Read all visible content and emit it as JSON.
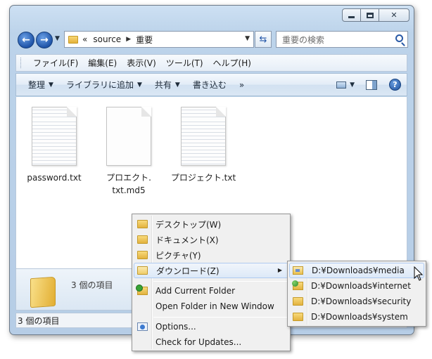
{
  "window": {
    "caption_buttons": {
      "minimize": "minimize",
      "maximize": "maximize",
      "close": "✕"
    }
  },
  "address": {
    "overflow": "«",
    "crumbs": [
      "source",
      "重要"
    ],
    "search_placeholder": "重要の検索"
  },
  "menubar": {
    "items": [
      "ファイル(F)",
      "編集(E)",
      "表示(V)",
      "ツール(T)",
      "ヘルプ(H)"
    ]
  },
  "commandbar": {
    "organize": "整理",
    "add_to_library": "ライブラリに追加",
    "share": "共有",
    "burn": "書き込む",
    "more": "»",
    "help": "?"
  },
  "files": [
    {
      "name": "password.txt",
      "icon": "text-file-icon"
    },
    {
      "name": "プロエクト.\ntxt.md5",
      "icon": "blank-file-icon"
    },
    {
      "name": "プロジェクト.txt",
      "icon": "text-file-icon"
    }
  ],
  "details": {
    "count": "3 個の項目"
  },
  "status": {
    "text": "3 個の項目"
  },
  "context_menu": {
    "items": [
      {
        "label": "デスクトップ(W)",
        "icon": "folder-icon"
      },
      {
        "label": "ドキュメント(X)",
        "icon": "folder-icon"
      },
      {
        "label": "ピクチャ(Y)",
        "icon": "folder-icon"
      },
      {
        "label": "ダウンロード(Z)",
        "icon": "open-folder-icon",
        "highlighted": true,
        "has_submenu": true
      },
      {
        "label": "Add Current Folder",
        "icon": "add-folder-icon"
      },
      {
        "label": "Open Folder in New Window",
        "icon": ""
      },
      {
        "label": "Options...",
        "icon": "options-icon"
      },
      {
        "label": "Check for Updates...",
        "icon": ""
      }
    ]
  },
  "submenu": {
    "items": [
      {
        "label": "D:¥Downloads¥media",
        "icon": "media-folder-icon",
        "highlighted": true
      },
      {
        "label": "D:¥Downloads¥internet",
        "icon": "internet-folder-icon"
      },
      {
        "label": "D:¥Downloads¥security",
        "icon": "folder-icon"
      },
      {
        "label": "D:¥Downloads¥system",
        "icon": "folder-icon"
      }
    ]
  },
  "colors": {
    "frame": "#bcd3ea",
    "highlight_border": "#aecaf0",
    "folder": "#e3b23e",
    "nav_button": "#1f54a8"
  }
}
